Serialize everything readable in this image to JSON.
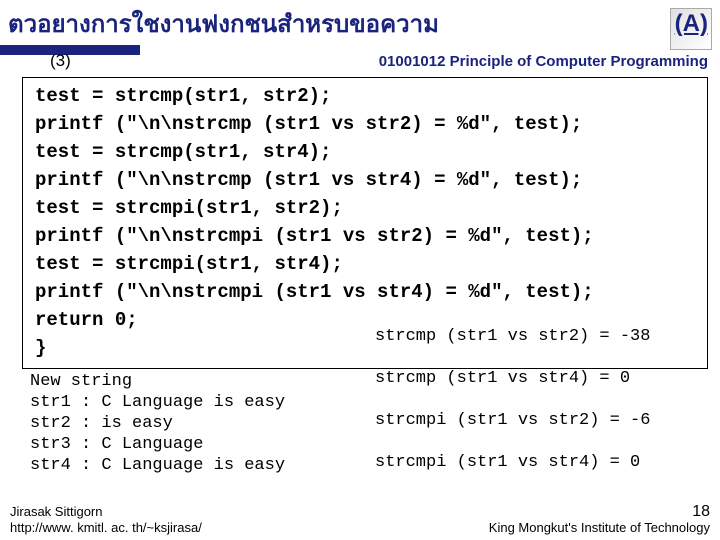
{
  "header": {
    "title": "ตวอยางการใชงานฟงกชนสำหรบขอความ",
    "extra": "(A)",
    "subleft": "(3)",
    "course": "01001012 Principle of Computer Programming"
  },
  "code": {
    "l1": "  test = strcmp(str1, str2);",
    "l2": "  printf   (\"\\n\\nstrcmp (str1 vs str2) = %d\", test);",
    "l3": "  test = strcmp(str1, str4);",
    "l4": "  printf   (\"\\n\\nstrcmp (str1 vs str4) = %d\", test);",
    "l5": "  test = strcmpi(str1, str2);",
    "l6": "  printf   (\"\\n\\nstrcmpi (str1 vs str2) = %d\", test);",
    "l7": "  test = strcmpi(str1, str4);",
    "l8": "  printf   (\"\\n\\nstrcmpi (str1 vs str4) = %d\", test);",
    "l9": "  return 0;",
    "l10": "}"
  },
  "output_left": "New string\nstr1 : C Language is easy\nstr2 : is easy\nstr3 : C Language\nstr4 : C Language is easy",
  "output_right": "strcmp (str1 vs str2) = -38\n\nstrcmp (str1 vs str4) = 0\n\nstrcmpi (str1 vs str2) = -6\n\nstrcmpi (str1 vs str4) = 0",
  "footer": {
    "author": "Jirasak Sittigorn",
    "url": "http://www. kmitl. ac. th/~ksjirasa/",
    "page": "18",
    "org": "King Mongkut's Institute of Technology"
  }
}
